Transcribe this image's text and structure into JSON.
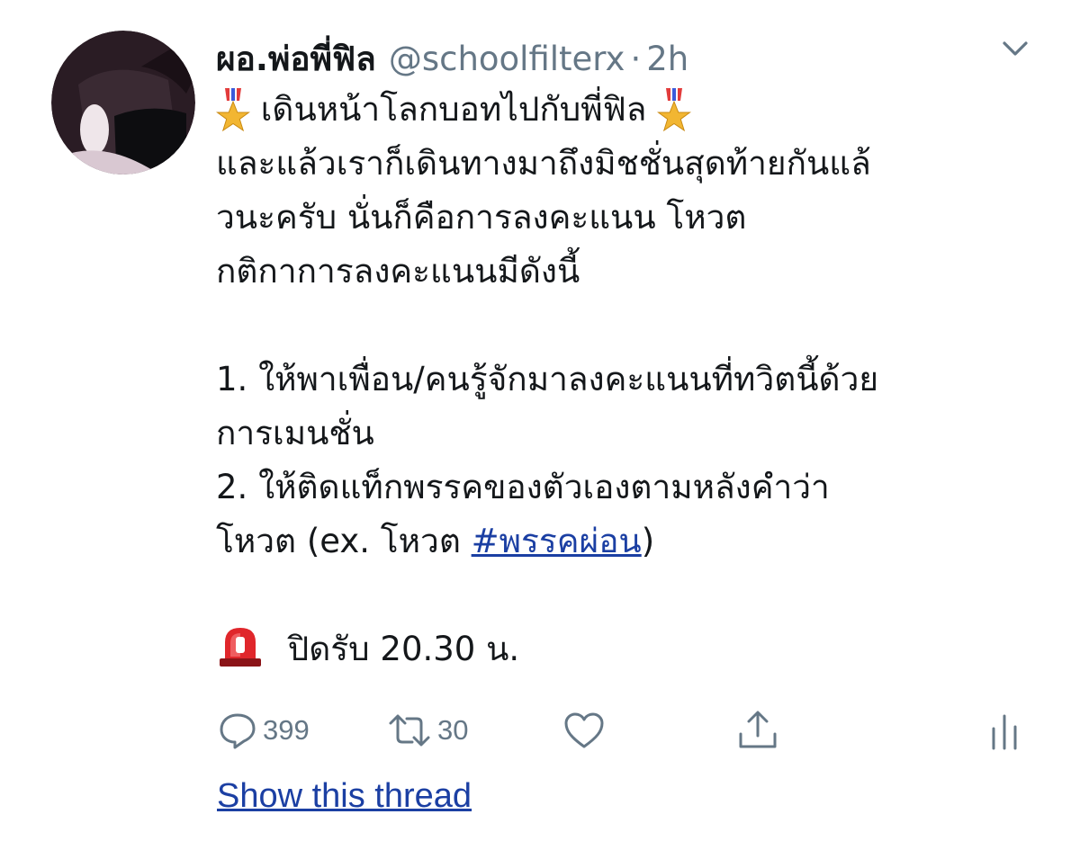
{
  "tweet": {
    "display_name": "ผอ.พ่อพี่ฟิล",
    "handle": "@schoolfilterx",
    "separator": "·",
    "time": "2h",
    "lines": {
      "l1": "เดินหน้าโลกบอทไปกับพี่ฟิล",
      "l2": "และแล้วเราก็เดินทางมาถึงมิชชั่นสุดท้ายกันแล้",
      "l3": "วนะครับ นั่นก็คือการลงคะแนน โหวต",
      "l4": "กติกาการลงคะแนนมีดังนี้",
      "l6": "1. ให้พาเพื่อน/คนรู้จักมาลงคะแนนที่ทวิตนี้ด้วย",
      "l7": "การเมนชั่น",
      "l8": "2. ให้ติดแท็กพรรคของตัวเองตามหลังคำว่า",
      "l9_prefix": "โหวต (ex. โหวต ",
      "l9_hashtag": "#พรรคผ่อน",
      "l9_suffix": ")",
      "l11": "ปิดรับ 20.30 น."
    }
  },
  "actions": {
    "reply_count": "399",
    "retweet_count": "30"
  },
  "show_thread": "Show this thread",
  "icons": {
    "avatar": "avatar",
    "chevron": "chevron-down-icon",
    "medal": "military-medal-icon",
    "siren": "rotating-light-icon",
    "reply": "reply-icon",
    "retweet": "retweet-icon",
    "like": "heart-icon",
    "share": "share-icon",
    "analytics": "analytics-icon"
  },
  "colors": {
    "text": "#14171a",
    "muted": "#657786",
    "link": "#1b3fa3",
    "siren": "#e0262b"
  }
}
